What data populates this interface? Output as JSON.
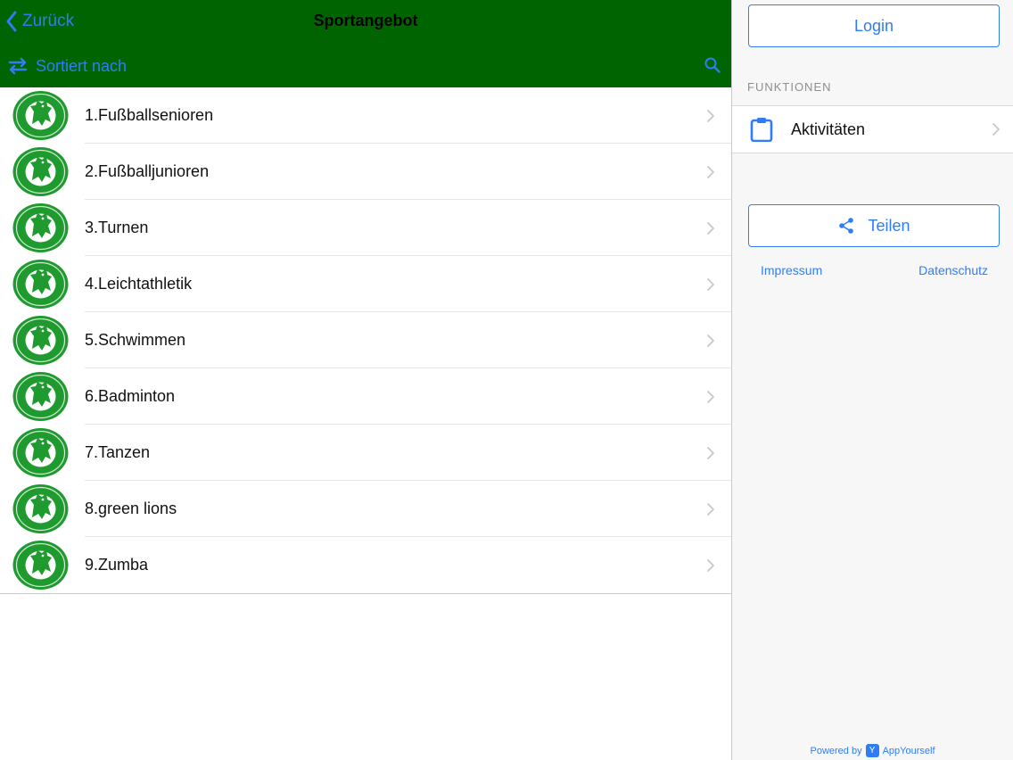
{
  "header": {
    "back_label": "Zurück",
    "title": "Sportangebot",
    "sort_label": "Sortiert nach"
  },
  "list": {
    "items": [
      {
        "label": "1.Fußballsenioren"
      },
      {
        "label": "2.Fußballjunioren"
      },
      {
        "label": "3.Turnen"
      },
      {
        "label": "4.Leichtathletik"
      },
      {
        "label": "5.Schwimmen"
      },
      {
        "label": "6.Badminton"
      },
      {
        "label": "7.Tanzen"
      },
      {
        "label": "8.green lions"
      },
      {
        "label": "9.Zumba"
      }
    ]
  },
  "sidebar": {
    "login_label": "Login",
    "section_title": "FUNKTIONEN",
    "functions": [
      {
        "label": "Aktivitäten",
        "icon": "clipboard-icon"
      }
    ],
    "share_label": "Teilen",
    "impressum_label": "Impressum",
    "datenschutz_label": "Datenschutz",
    "powered_by": "Powered by",
    "powered_brand": "AppYourself"
  },
  "colors": {
    "header_bg": "#006400",
    "accent": "#2f7df6",
    "logo_green": "#1f9a2e"
  }
}
